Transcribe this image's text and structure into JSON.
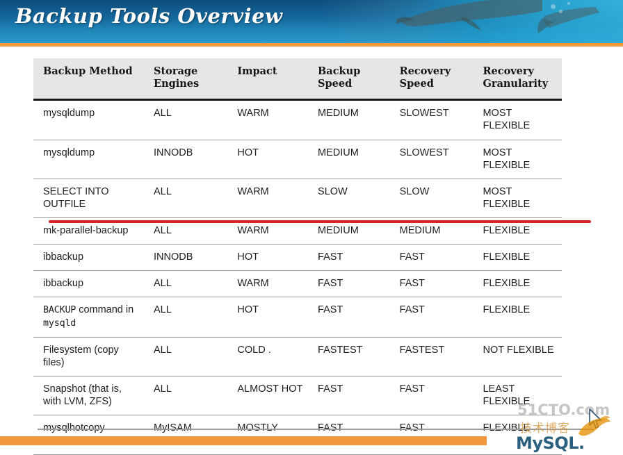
{
  "slide": {
    "title": "Backup Tools Overview",
    "accent_color": "#f2983c",
    "banner_color": "#14659a"
  },
  "table": {
    "headers": [
      "Backup Method",
      "Storage Engines",
      "Impact",
      "Backup Speed",
      "Recovery Speed",
      "Recovery Granularity"
    ],
    "rows": [
      {
        "method": "mysqldump",
        "engines": "ALL",
        "impact": "WARM",
        "backup_speed": "MEDIUM",
        "recovery_speed": "SLOWEST",
        "granularity": "MOST FLEXIBLE",
        "struck": false
      },
      {
        "method": "mysqldump",
        "engines": "INNODB",
        "impact": "HOT",
        "backup_speed": "MEDIUM",
        "recovery_speed": "SLOWEST",
        "granularity": "MOST FLEXIBLE",
        "struck": false
      },
      {
        "method": "SELECT INTO OUTFILE",
        "engines": "ALL",
        "impact": "WARM",
        "backup_speed": "SLOW",
        "recovery_speed": "SLOW",
        "granularity": "MOST FLEXIBLE",
        "struck": false
      },
      {
        "method": "mk-parallel-backup",
        "engines": "ALL",
        "impact": "WARM",
        "backup_speed": "MEDIUM",
        "recovery_speed": "MEDIUM",
        "granularity": "FLEXIBLE",
        "struck": true
      },
      {
        "method": "ibbackup",
        "engines": "INNODB",
        "impact": "HOT",
        "backup_speed": "FAST",
        "recovery_speed": "FAST",
        "granularity": "FLEXIBLE",
        "struck": false
      },
      {
        "method": "ibbackup",
        "engines": "ALL",
        "impact": "WARM",
        "backup_speed": "FAST",
        "recovery_speed": "FAST",
        "granularity": "FLEXIBLE",
        "struck": false
      },
      {
        "method": "BACKUP command in mysqld",
        "method_mono_1": "BACKUP",
        "method_plain_1": " command in ",
        "method_mono_2": "mysqld",
        "engines": "ALL",
        "impact": "HOT",
        "backup_speed": "FAST",
        "recovery_speed": "FAST",
        "granularity": "FLEXIBLE",
        "struck": false
      },
      {
        "method": "Filesystem (copy files)",
        "engines": "ALL",
        "impact": "COLD .",
        "backup_speed": "FASTEST",
        "recovery_speed": "FASTEST",
        "granularity": "NOT FLEXIBLE",
        "struck": false
      },
      {
        "method": "Snapshot (that is, with LVM, ZFS)",
        "engines": "ALL",
        "impact": "ALMOST HOT",
        "backup_speed": "FAST",
        "recovery_speed": "FAST",
        "granularity": "LEAST FLEXIBLE",
        "struck": false
      },
      {
        "method": "mysqlhotcopy",
        "engines": "MyISAM",
        "impact": "MOSTLY COLD",
        "backup_speed": "FAST",
        "recovery_speed": "FAST",
        "granularity": "FLEXIBLE",
        "struck": false
      }
    ]
  },
  "watermark": {
    "site": "51CTO.com",
    "subtitle": "技术博客",
    "logo_text": "MySQL."
  }
}
